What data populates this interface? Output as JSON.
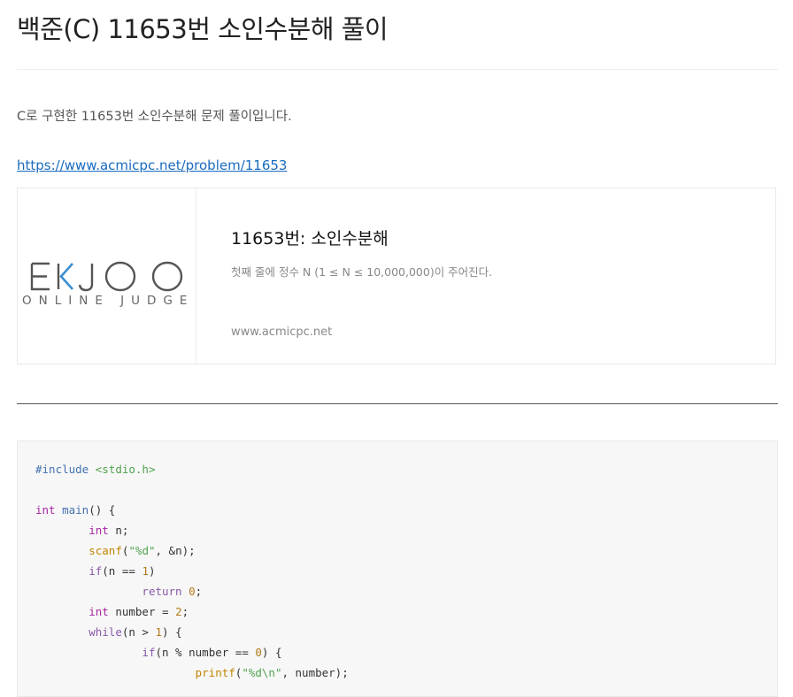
{
  "post": {
    "title": "백준(C) 11653번 소인수분해 풀이",
    "intro": "C로 구현한 11653번 소인수분해 문제 풀이입니다.",
    "problem_url": "https://www.acmicpc.net/problem/11653"
  },
  "og_card": {
    "thumb_brand_main": "EKJOO",
    "thumb_brand_sub": "ONLINE JUDGE",
    "title": "11653번: 소인수분해",
    "description": "첫째 줄에 정수 N (1 ≤ N ≤ 10,000,000)이 주어진다.",
    "domain": "www.acmicpc.net"
  },
  "code": {
    "language": "c",
    "lines": [
      "#include <stdio.h>",
      "",
      "int main() {",
      "        int n;",
      "        scanf(\"%d\", &n);",
      "        if(n == 1)",
      "                return 0;",
      "        int number = 2;",
      "        while(n > 1) {",
      "                if(n % number == 0) {",
      "                        printf(\"%d\\n\", number);"
    ]
  },
  "colors": {
    "link": "#1a6bbf",
    "logo_accent": "#3b8fd1",
    "code_bg": "#f7f7f7"
  }
}
